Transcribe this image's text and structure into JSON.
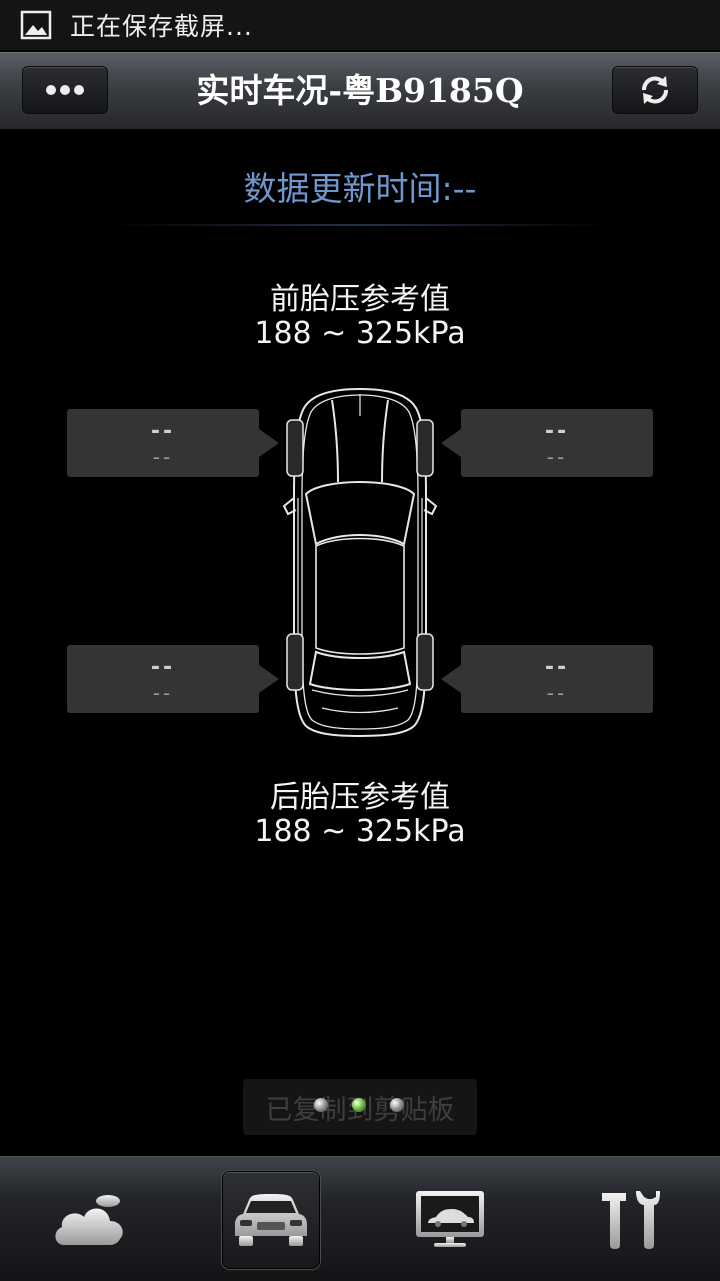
{
  "status_bar": {
    "notification_icon": "image-icon",
    "text": "正在保存截屏..."
  },
  "header": {
    "title": "实时车况-粤B9185Q",
    "menu_icon": "more-icon",
    "refresh_icon": "refresh-icon"
  },
  "update": {
    "label": "数据更新时间:--"
  },
  "front": {
    "label": "前胎压参考值",
    "value": "188 ~ 325kPa"
  },
  "rear": {
    "label": "后胎压参考值",
    "value": "188 ~ 325kPa"
  },
  "tires": {
    "front_left": {
      "pressure": "--",
      "temperature": "--"
    },
    "front_right": {
      "pressure": "--",
      "temperature": "--"
    },
    "rear_left": {
      "pressure": "--",
      "temperature": "--"
    },
    "rear_right": {
      "pressure": "--",
      "temperature": "--"
    }
  },
  "toast": {
    "text": "已复制到剪贴板"
  },
  "page_indicator": {
    "count": 3,
    "active_index": 1,
    "active_color": "#6ec43a",
    "inactive_color": "#9a9a9a"
  },
  "bottom_nav": {
    "items": [
      {
        "icon": "cloud-icon",
        "active": false
      },
      {
        "icon": "car-icon",
        "active": true
      },
      {
        "icon": "monitor-car-icon",
        "active": false
      },
      {
        "icon": "tools-icon",
        "active": false
      }
    ]
  },
  "colors": {
    "accent_text": "#6f97cc",
    "background": "#000000"
  }
}
